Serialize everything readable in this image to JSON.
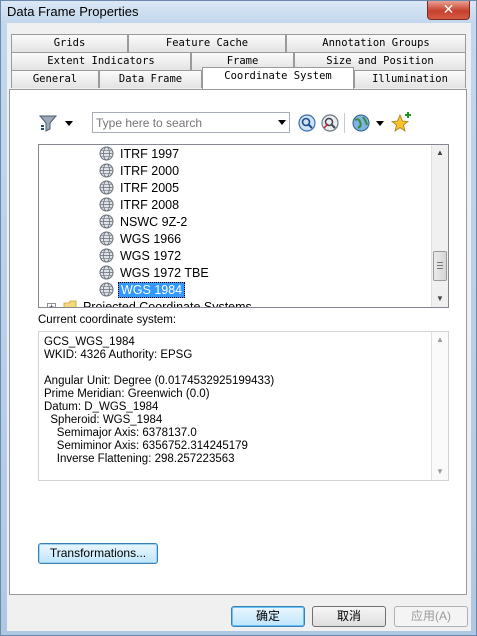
{
  "window": {
    "title": "Data Frame Properties",
    "close_glyph": "✕"
  },
  "tabs": {
    "row1": [
      "Grids",
      "Feature Cache",
      "Annotation Groups"
    ],
    "row2": [
      "Extent Indicators",
      "Frame",
      "Size and Position"
    ],
    "row3": [
      "General",
      "Data Frame",
      "Coordinate System",
      "Illumination"
    ],
    "active": "Coordinate System"
  },
  "toolbar": {
    "search_placeholder": "Type here to search",
    "icons": [
      "filter-icon",
      "search-icon",
      "clear-search-icon",
      "globe-dropdown-icon",
      "add-favorite-icon"
    ]
  },
  "tree": {
    "items": [
      "ITRF 1997",
      "ITRF 2000",
      "ITRF 2005",
      "ITRF 2008",
      "NSWC 9Z-2",
      "WGS 1966",
      "WGS 1972",
      "WGS 1972 TBE",
      "WGS 1984"
    ],
    "selected": "WGS 1984",
    "partial_item": "Projected Coordinate Systems",
    "expand_glyph": "+"
  },
  "current": {
    "label": "Current coordinate system:",
    "lines": [
      "GCS_WGS_1984",
      "WKID: 4326 Authority: EPSG",
      "",
      "Angular Unit: Degree (0.0174532925199433)",
      "Prime Meridian: Greenwich (0.0)",
      "Datum: D_WGS_1984",
      "  Spheroid: WGS_1984",
      "    Semimajor Axis: 6378137.0",
      "    Semiminor Axis: 6356752.314245179",
      "    Inverse Flattening: 298.257223563"
    ]
  },
  "buttons": {
    "transformations": "Transformations...",
    "ok": "确定",
    "cancel": "取消",
    "apply": "应用(A)"
  },
  "colors": {
    "selection": "#3399ff",
    "close": "#c7402c"
  }
}
